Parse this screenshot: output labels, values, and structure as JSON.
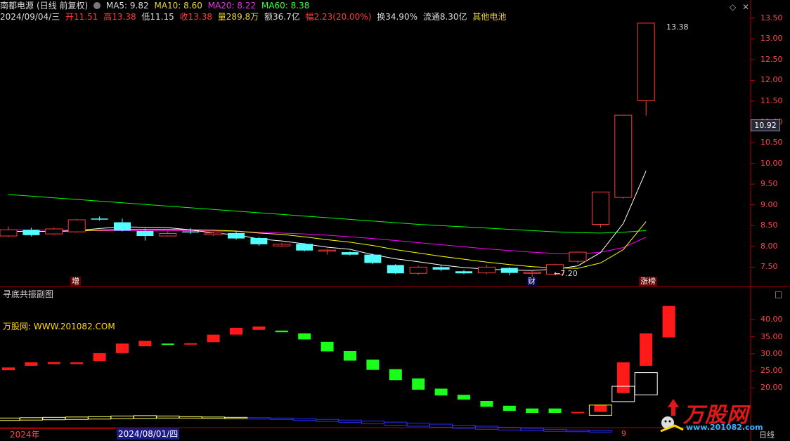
{
  "header": {
    "stock_name": "南都电源",
    "period": "(日线 前复权)",
    "ma5": "MA5: 9.82",
    "ma10": "MA10: 8.60",
    "ma20": "MA20: 8.22",
    "ma60": "MA60: 8.38",
    "date": "2024/09/04/三",
    "open": "开11.51",
    "high": "高13.38",
    "low": "低11.15",
    "close": "收13.38",
    "volume": "量289.8万",
    "amount": "额36.7亿",
    "change": "幅2.23(20.00%)",
    "turnover": "换34.90%",
    "float": "流通8.30亿",
    "sector": "其他电池"
  },
  "icons": {
    "diamond": "diamond-icon",
    "close": "close-icon",
    "window": "window-icon"
  },
  "price_axis": [
    "13.50",
    "13.00",
    "12.50",
    "12.00",
    "11.50",
    "11.00",
    "10.50",
    "10.00",
    "9.50",
    "9.00",
    "8.50",
    "8.00",
    "7.50"
  ],
  "current_price": "10.92",
  "annotations": {
    "high_label": "13.38",
    "low_label": "←7.20",
    "tag_zeng": "增",
    "tag_cai": "财",
    "tag_zhangbang": "涨榜"
  },
  "sub_chart": {
    "title": "寻底共振副图",
    "site": "万股网: WWW.201082.COM",
    "axis": [
      "40.00",
      "35.00",
      "30.00",
      "25.00",
      "20.00"
    ]
  },
  "bottom": {
    "year": "2024年",
    "date": "2024/08/01/四",
    "nine": "9",
    "period": "日线"
  },
  "logo": {
    "name": "万股网",
    "url": "www.201082.com"
  },
  "colors": {
    "up": "#ff3c3c",
    "down": "#54ffff",
    "ma5": "#ffffff",
    "ma10": "#ffff00",
    "ma20": "#ff00ff",
    "ma60": "#00ff00"
  },
  "chart_data": {
    "type": "candlestick",
    "candles": [
      {
        "o": 8.25,
        "c": 8.4,
        "h": 8.48,
        "l": 8.22
      },
      {
        "o": 8.4,
        "c": 8.27,
        "h": 8.45,
        "l": 8.24
      },
      {
        "o": 8.3,
        "c": 8.42,
        "h": 8.45,
        "l": 8.28
      },
      {
        "o": 8.35,
        "c": 8.64,
        "h": 8.66,
        "l": 8.33
      },
      {
        "o": 8.67,
        "c": 8.65,
        "h": 8.72,
        "l": 8.62
      },
      {
        "o": 8.58,
        "c": 8.38,
        "h": 8.67,
        "l": 8.36
      },
      {
        "o": 8.37,
        "c": 8.25,
        "h": 8.43,
        "l": 8.14
      },
      {
        "o": 8.25,
        "c": 8.31,
        "h": 8.37,
        "l": 8.24
      },
      {
        "o": 8.36,
        "c": 8.35,
        "h": 8.44,
        "l": 8.3
      },
      {
        "o": 8.28,
        "c": 8.32,
        "h": 8.35,
        "l": 8.25
      },
      {
        "o": 8.32,
        "c": 8.19,
        "h": 8.36,
        "l": 8.16
      },
      {
        "o": 8.2,
        "c": 8.05,
        "h": 8.23,
        "l": 8.01
      },
      {
        "o": 8.01,
        "c": 8.05,
        "h": 8.08,
        "l": 7.99
      },
      {
        "o": 8.06,
        "c": 7.9,
        "h": 8.08,
        "l": 7.88
      },
      {
        "o": 7.9,
        "c": 7.91,
        "h": 7.94,
        "l": 7.8
      },
      {
        "o": 7.86,
        "c": 7.8,
        "h": 7.88,
        "l": 7.78
      },
      {
        "o": 7.8,
        "c": 7.6,
        "h": 7.83,
        "l": 7.57
      },
      {
        "o": 7.55,
        "c": 7.35,
        "h": 7.57,
        "l": 7.33
      },
      {
        "o": 7.35,
        "c": 7.5,
        "h": 7.53,
        "l": 7.32
      },
      {
        "o": 7.5,
        "c": 7.44,
        "h": 7.55,
        "l": 7.4
      },
      {
        "o": 7.4,
        "c": 7.35,
        "h": 7.43,
        "l": 7.33
      },
      {
        "o": 7.36,
        "c": 7.5,
        "h": 7.55,
        "l": 7.33
      },
      {
        "o": 7.48,
        "c": 7.36,
        "h": 7.5,
        "l": 7.3
      },
      {
        "o": 7.35,
        "c": 7.38,
        "h": 7.42,
        "l": 7.2
      },
      {
        "o": 7.33,
        "c": 7.56,
        "h": 7.58,
        "l": 7.31
      },
      {
        "o": 7.64,
        "c": 7.86,
        "h": 7.88,
        "l": 7.6
      },
      {
        "o": 8.53,
        "c": 9.31,
        "h": 9.31,
        "l": 8.45
      },
      {
        "o": 9.18,
        "c": 11.16,
        "h": 11.16,
        "l": 9.15
      },
      {
        "o": 11.51,
        "c": 13.38,
        "h": 13.38,
        "l": 11.15
      }
    ],
    "ma5": [
      8.36,
      8.36,
      8.36,
      8.38,
      8.43,
      8.47,
      8.46,
      8.45,
      8.4,
      8.32,
      8.28,
      8.18,
      8.13,
      8.06,
      7.98,
      7.93,
      7.8,
      7.7,
      7.63,
      7.55,
      7.49,
      7.45,
      7.43,
      7.42,
      7.45,
      7.53,
      7.85,
      8.55,
      9.82
    ],
    "ma10": [
      8.36,
      8.36,
      8.36,
      8.37,
      8.39,
      8.41,
      8.41,
      8.41,
      8.4,
      8.39,
      8.37,
      8.32,
      8.29,
      8.23,
      8.16,
      8.1,
      8.02,
      7.92,
      7.84,
      7.76,
      7.69,
      7.62,
      7.56,
      7.51,
      7.48,
      7.47,
      7.6,
      7.92,
      8.6
    ],
    "ma20": [
      8.4,
      8.39,
      8.39,
      8.39,
      8.38,
      8.38,
      8.38,
      8.38,
      8.38,
      8.37,
      8.36,
      8.34,
      8.32,
      8.3,
      8.27,
      8.23,
      8.19,
      8.14,
      8.09,
      8.04,
      7.99,
      7.94,
      7.9,
      7.86,
      7.83,
      7.81,
      7.86,
      7.97,
      8.22
    ],
    "ma60": [
      9.25,
      9.21,
      9.17,
      9.13,
      9.09,
      9.05,
      9.01,
      8.97,
      8.93,
      8.89,
      8.85,
      8.81,
      8.77,
      8.73,
      8.69,
      8.65,
      8.61,
      8.57,
      8.53,
      8.5,
      8.47,
      8.44,
      8.41,
      8.38,
      8.35,
      8.33,
      8.32,
      8.34,
      8.38
    ],
    "price_range": [
      7.1,
      13.7
    ],
    "sub_bars": [
      {
        "lo": 25.2,
        "hi": 26.0,
        "c": "r"
      },
      {
        "lo": 26.5,
        "hi": 27.5,
        "c": "r"
      },
      {
        "lo": 27.0,
        "hi": 27.6,
        "c": "r"
      },
      {
        "lo": 27.0,
        "hi": 27.5,
        "c": "r"
      },
      {
        "lo": 27.9,
        "hi": 30.2,
        "c": "r"
      },
      {
        "lo": 30.2,
        "hi": 33.0,
        "c": "r"
      },
      {
        "lo": 32.2,
        "hi": 33.8,
        "c": "r"
      },
      {
        "lo": 32.6,
        "hi": 33.0,
        "c": "g"
      },
      {
        "lo": 32.9,
        "hi": 33.1,
        "c": "r"
      },
      {
        "lo": 33.4,
        "hi": 35.6,
        "c": "r"
      },
      {
        "lo": 35.6,
        "hi": 37.6,
        "c": "r"
      },
      {
        "lo": 37.0,
        "hi": 38.0,
        "c": "r"
      },
      {
        "lo": 36.3,
        "hi": 36.8,
        "c": "g"
      },
      {
        "lo": 34.2,
        "hi": 36.0,
        "c": "g"
      },
      {
        "lo": 30.7,
        "hi": 33.5,
        "c": "g"
      },
      {
        "lo": 28.0,
        "hi": 30.8,
        "c": "g"
      },
      {
        "lo": 25.3,
        "hi": 28.3,
        "c": "g"
      },
      {
        "lo": 22.3,
        "hi": 25.5,
        "c": "g"
      },
      {
        "lo": 19.5,
        "hi": 22.8,
        "c": "g"
      },
      {
        "lo": 17.8,
        "hi": 19.8,
        "c": "g"
      },
      {
        "lo": 16.6,
        "hi": 18.0,
        "c": "g"
      },
      {
        "lo": 14.5,
        "hi": 16.2,
        "c": "g"
      },
      {
        "lo": 13.3,
        "hi": 14.8,
        "c": "g"
      },
      {
        "lo": 12.7,
        "hi": 14.0,
        "c": "g"
      },
      {
        "lo": 12.7,
        "hi": 14.0,
        "c": "g"
      },
      {
        "lo": 12.7,
        "hi": 13.0,
        "c": "r"
      },
      {
        "lo": 13.0,
        "hi": 15.0,
        "c": "r"
      },
      {
        "lo": 18.5,
        "hi": 27.5,
        "c": "r"
      },
      {
        "lo": 26.5,
        "hi": 36.0,
        "c": "r"
      },
      {
        "lo": 34.8,
        "hi": 44.0,
        "c": "r"
      }
    ],
    "sub_range": [
      9,
      46
    ],
    "sub_boxes_yellow": [
      {
        "lo": 10.5,
        "hi": 11.2
      },
      {
        "lo": 10.6,
        "hi": 11.3
      },
      {
        "lo": 10.7,
        "hi": 11.4
      },
      {
        "lo": 10.8,
        "hi": 11.5
      },
      {
        "lo": 10.9,
        "hi": 11.6
      },
      {
        "lo": 11.0,
        "hi": 11.8
      },
      {
        "lo": 11.1,
        "hi": 11.9
      },
      {
        "lo": 11.2,
        "hi": 11.8
      },
      {
        "lo": 11.2,
        "hi": 11.6
      },
      {
        "lo": 11.2,
        "hi": 11.5
      },
      {
        "lo": 11.2,
        "hi": 11.4
      }
    ],
    "sub_boxes_blue": [
      {
        "lo": 11.0,
        "hi": 11.3
      },
      {
        "lo": 10.8,
        "hi": 11.2
      },
      {
        "lo": 10.5,
        "hi": 11.0
      },
      {
        "lo": 10.2,
        "hi": 10.8
      },
      {
        "lo": 9.9,
        "hi": 10.6
      },
      {
        "lo": 9.5,
        "hi": 10.3
      },
      {
        "lo": 9.1,
        "hi": 10.0
      },
      {
        "lo": 8.8,
        "hi": 9.7
      },
      {
        "lo": 8.5,
        "hi": 9.4
      },
      {
        "lo": 8.2,
        "hi": 9.1
      },
      {
        "lo": 7.9,
        "hi": 8.8
      },
      {
        "lo": 7.7,
        "hi": 8.5
      },
      {
        "lo": 7.5,
        "hi": 8.2
      },
      {
        "lo": 7.3,
        "hi": 7.9
      },
      {
        "lo": 7.2,
        "hi": 7.7
      },
      {
        "lo": 7.1,
        "hi": 7.5
      }
    ],
    "sub_boxes_end": [
      {
        "lo": 12.0,
        "hi": 15.0,
        "c": "#ffff00"
      },
      {
        "lo": 16.0,
        "hi": 20.5,
        "c": "#ffffff"
      },
      {
        "lo": 18.0,
        "hi": 24.5,
        "c": "#ffffff"
      }
    ]
  }
}
